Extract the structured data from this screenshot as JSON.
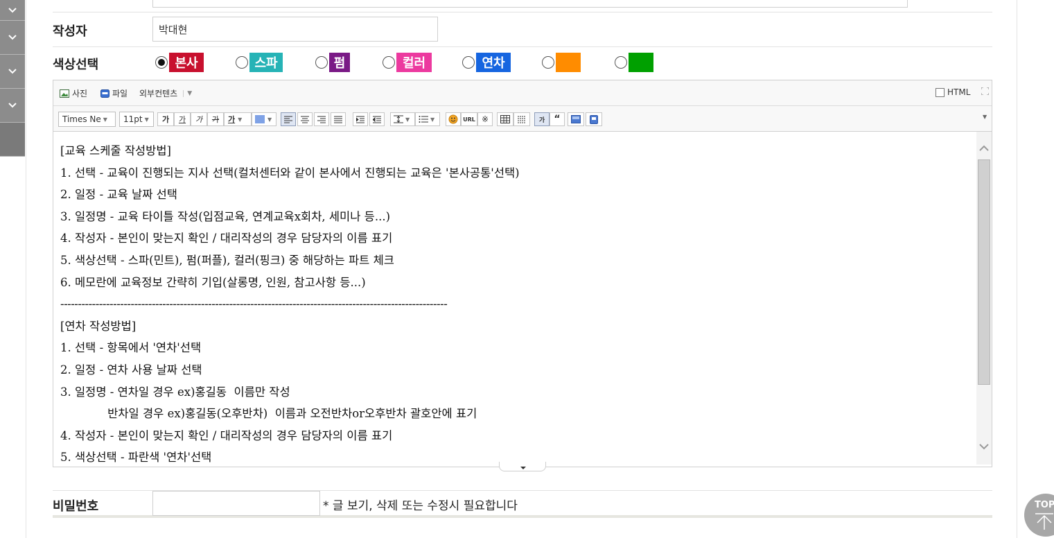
{
  "form": {
    "writer": {
      "label": "작성자",
      "value": "박대현"
    },
    "color_select": {
      "label": "색상선택",
      "options": [
        {
          "label": "본사",
          "color": "#c8102e",
          "checked": true
        },
        {
          "label": "스파",
          "color": "#26b3b6",
          "checked": false
        },
        {
          "label": "펌",
          "color": "#7a1a86",
          "checked": false
        },
        {
          "label": "컬러",
          "color": "#ec3a9f",
          "checked": false
        },
        {
          "label": "연차",
          "color": "#1665e0",
          "checked": false
        },
        {
          "label": "",
          "color": "#ff8c00",
          "checked": false
        },
        {
          "label": "",
          "color": "#00a000",
          "checked": false
        }
      ]
    },
    "password": {
      "label": "비밀번호",
      "value": "",
      "hint": "* 글 보기, 삭제 또는 수정시 필요합니다"
    }
  },
  "editor": {
    "toolbar1": {
      "photo": "사진",
      "file": "파일",
      "external": "외부컨텐츠",
      "html": "HTML"
    },
    "toolbar2": {
      "font": "Times Ne",
      "size": "11pt",
      "bold": "가",
      "underline": "가",
      "italic": "가",
      "strike": "가",
      "textcolor": "가",
      "url": "URL"
    },
    "lines": [
      "[교육 스케줄 작성방법]",
      "1. 선택 - 교육이 진행되는 지사 선택(컬처센터와 같이 본사에서 진행되는 교육은 '본사공통'선택)",
      "2. 일정 - 교육 날짜 선택",
      "3. 일정명 - 교육 타이틀 작성(입점교육, 연계교육x회차, 세미나 등...)",
      "4. 작성자 - 본인이 맞는지 확인 / 대리작성의 경우 담당자의 이름 표기",
      "5. 색상선택 - 스파(민트), 펌(퍼플), 컬러(핑크) 중 해당하는 파트 체크",
      "6. 메모란에 교육정보 간략히 기입(살롱명, 인원, 참고사항 등...)",
      "--------------------------------------------------------------------------------------------------------------",
      "[연차 작성방법]",
      "1. 선택 - 항목에서 '연차'선택",
      "2. 일정 - 연차 사용 날짜 선택",
      "3. 일정명 - 연차일 경우 ex)홍길동  이름만 작성",
      "             반차일 경우 ex)홍길동(오후반차)  이름과 오전반차or오후반차 괄호안에 표기",
      "4. 작성자 - 본인이 맞는지 확인 / 대리작성의 경우 담당자의 이름 표기",
      "5. 색상선택 - 파란색 '연차'선택"
    ]
  },
  "top_button": {
    "label": "TOP"
  }
}
